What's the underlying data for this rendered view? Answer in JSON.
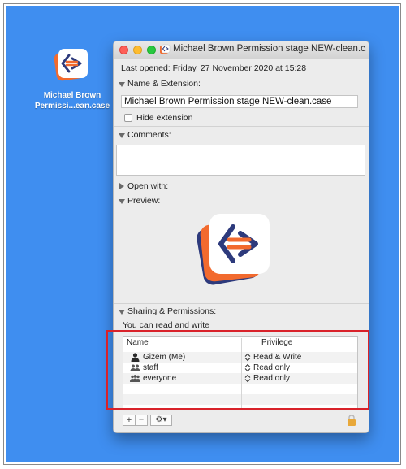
{
  "desktop": {
    "file_label_line1": "Michael Brown",
    "file_label_line2": "Permissi...ean.case",
    "file_icon": "case-file-icon"
  },
  "window": {
    "title": "Michael Brown Permission stage NEW-clean.c...",
    "last_opened_label": "Last opened:",
    "last_opened_value": "Friday, 27 November 2020 at 15:28",
    "sections": {
      "name_extension": "Name & Extension:",
      "comments": "Comments:",
      "open_with": "Open with:",
      "preview": "Preview:",
      "sharing": "Sharing & Permissions:"
    },
    "name_value": "Michael Brown Permission stage NEW-clean.case",
    "hide_extension_label": "Hide extension",
    "hide_extension_checked": false,
    "sharing_status": "You can read and write",
    "table": {
      "headers": [
        "Name",
        "Privilege"
      ],
      "rows": [
        {
          "name": "Gizem (Me)",
          "privilege": "Read & Write",
          "icon": "user-icon"
        },
        {
          "name": "staff",
          "privilege": "Read only",
          "icon": "group-icon"
        },
        {
          "name": "everyone",
          "privilege": "Read only",
          "icon": "group-icon"
        }
      ]
    },
    "buttons": {
      "add": "+",
      "remove": "−",
      "gear": "⚙▾"
    }
  },
  "colors": {
    "desktop": "#3f8ef0",
    "highlight_box": "#d9222a",
    "icon_orange": "#f26a2e",
    "icon_navy": "#2d3a7c"
  }
}
